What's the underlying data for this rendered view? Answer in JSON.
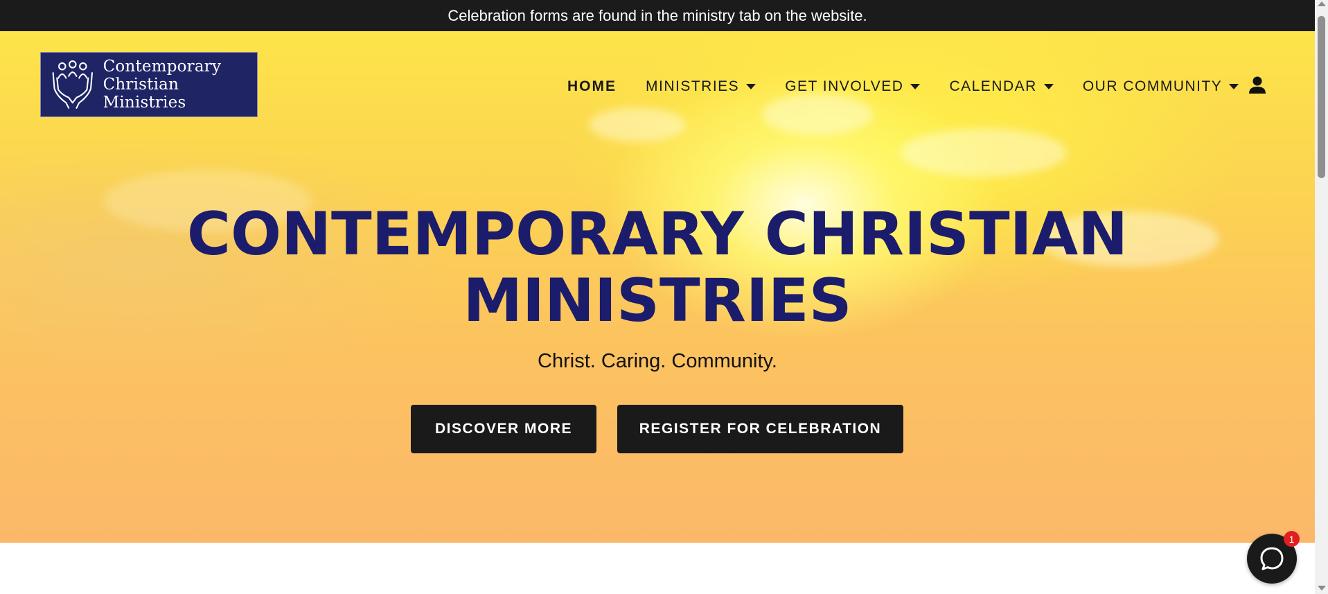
{
  "announcement": {
    "text": "Celebration forms are found in the ministry tab on the website."
  },
  "logo": {
    "line1": "Contemporary",
    "line2": "Christian Ministries",
    "icon": "praying-hands-people-icon"
  },
  "nav": {
    "items": [
      {
        "label": "HOME",
        "active": true,
        "dropdown": false
      },
      {
        "label": "MINISTRIES",
        "active": false,
        "dropdown": true
      },
      {
        "label": "GET INVOLVED",
        "active": false,
        "dropdown": true
      },
      {
        "label": "CALENDAR",
        "active": false,
        "dropdown": true
      },
      {
        "label": "OUR COMMUNITY",
        "active": false,
        "dropdown": true
      }
    ],
    "account_icon": "user-icon"
  },
  "hero": {
    "title_line1": "CONTEMPORARY CHRISTIAN",
    "title_line2": "MINISTRIES",
    "tagline": "Christ. Caring. Community.",
    "buttons": {
      "discover": "DISCOVER MORE",
      "register": "REGISTER FOR CELEBRATION"
    }
  },
  "chat": {
    "icon": "chat-bubble-icon",
    "badge_count": "1"
  },
  "colors": {
    "brand_navy": "#1c1c6c",
    "button_bg": "#1a1a1a",
    "announcement_bg": "#1b1b1b",
    "badge_red": "#e02020"
  }
}
